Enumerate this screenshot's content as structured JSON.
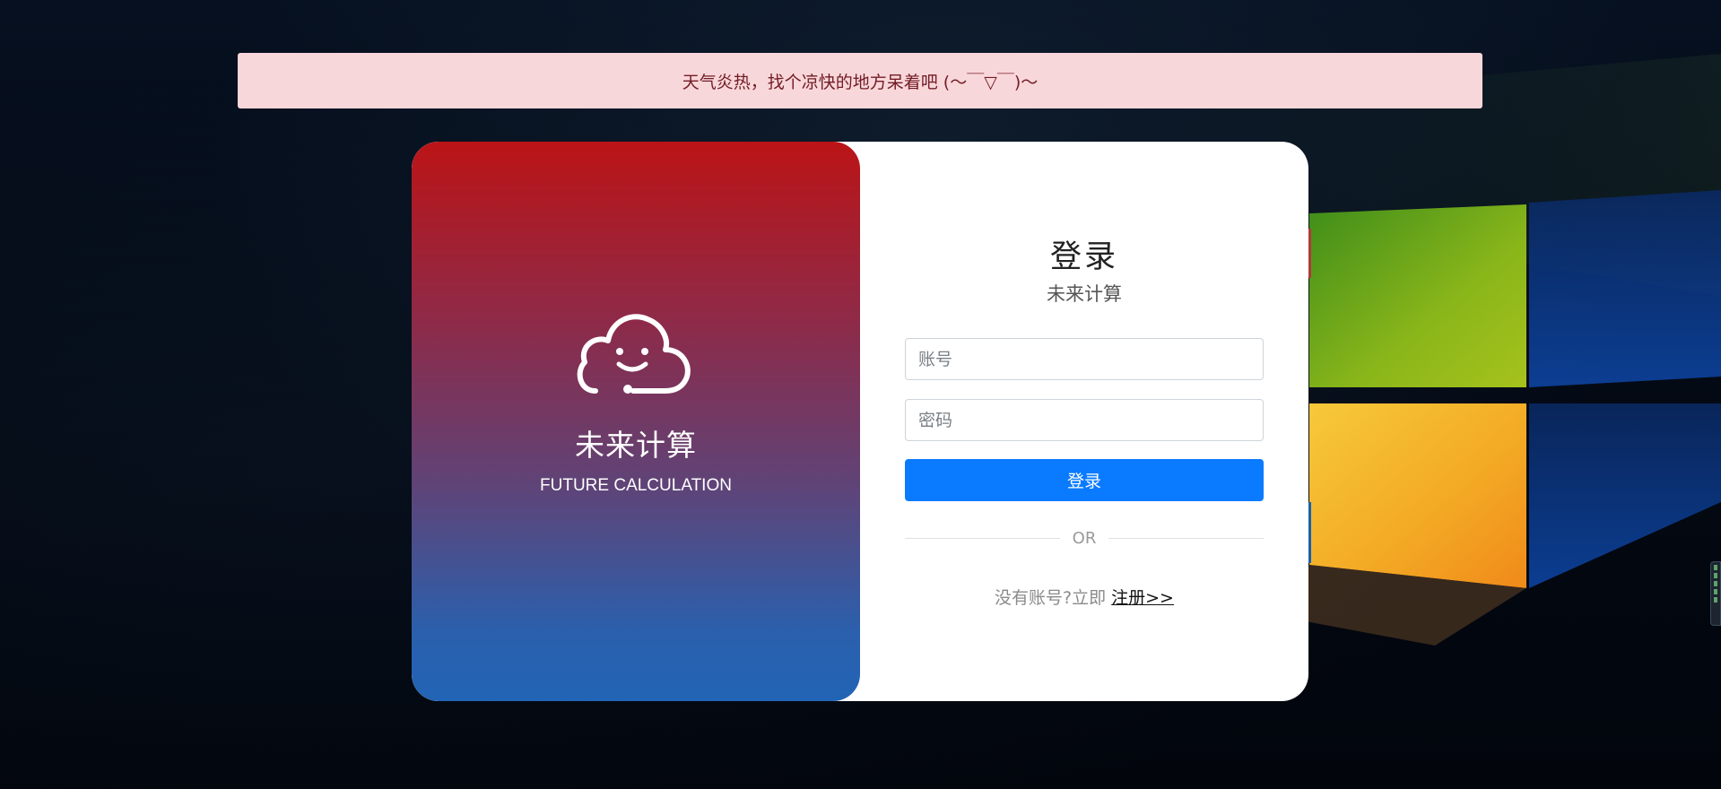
{
  "alert": {
    "message": "天气炎热，找个凉快的地方呆着吧 (～￣▽￣)～"
  },
  "brand": {
    "logo_icon": "cloud-smile-icon",
    "name": "未来计算",
    "tagline": "FUTURE CALCULATION"
  },
  "login": {
    "title": "登录",
    "subtitle": "未来计算",
    "account_placeholder": "账号",
    "password_placeholder": "密码",
    "submit_label": "登录",
    "divider_label": "OR",
    "register_prompt": "没有账号?立即 ",
    "register_link": "注册>>"
  },
  "colors": {
    "alert_bg": "#f8d7da",
    "alert_text": "#721c24",
    "primary": "#0a7bff",
    "gradient_top": "#bb1416",
    "gradient_bottom": "#2264b5"
  }
}
